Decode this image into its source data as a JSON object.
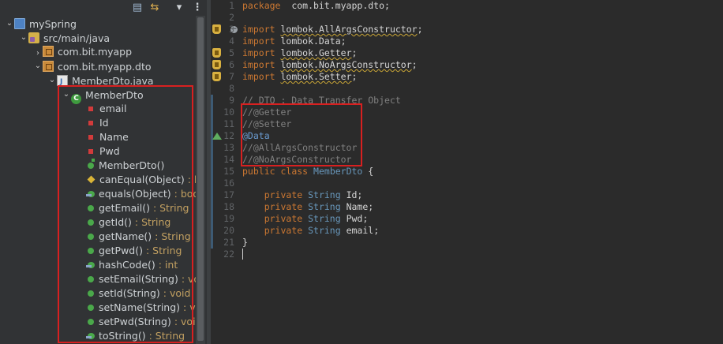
{
  "colors": {
    "highlight": "#d82020",
    "keyword": "#cc7832",
    "type": "#6897bb",
    "comment": "#808080",
    "annotation": "#6a9bd0",
    "return_type": "#c2a061"
  },
  "toolbar": {
    "icons": [
      "collapse-all-icon",
      "link-with-editor-icon",
      "filter-icon",
      "view-menu-icon"
    ],
    "menu_glyph": "⋮"
  },
  "tree": [
    {
      "label": "mySpring",
      "return": "",
      "icon": "project-icon",
      "expanded": true
    },
    {
      "label": "src/main/java",
      "return": "",
      "icon": "source-folder-icon",
      "expanded": true
    },
    {
      "label": "com.bit.myapp",
      "return": "",
      "icon": "package-icon",
      "expanded": false
    },
    {
      "label": "com.bit.myapp.dto",
      "return": "",
      "icon": "package-icon",
      "expanded": true
    },
    {
      "label": "MemberDto.java",
      "return": "",
      "icon": "java-file-icon",
      "expanded": true
    },
    {
      "label": "MemberDto",
      "return": "",
      "icon": "class-icon",
      "expanded": true
    },
    {
      "label": "email",
      "return": "",
      "icon": "private-field-icon"
    },
    {
      "label": "Id",
      "return": "",
      "icon": "private-field-icon"
    },
    {
      "label": "Name",
      "return": "",
      "icon": "private-field-icon"
    },
    {
      "label": "Pwd",
      "return": "",
      "icon": "private-field-icon"
    },
    {
      "label": "MemberDto()",
      "return": "",
      "icon": "constructor-icon"
    },
    {
      "label": "canEqual(Object)",
      "return": " : boo",
      "icon": "protected-method-icon"
    },
    {
      "label": "equals(Object)",
      "return": " : boolea",
      "icon": "override-method-icon"
    },
    {
      "label": "getEmail()",
      "return": " : String",
      "icon": "public-method-icon"
    },
    {
      "label": "getId()",
      "return": " : String",
      "icon": "public-method-icon"
    },
    {
      "label": "getName()",
      "return": " : String",
      "icon": "public-method-icon"
    },
    {
      "label": "getPwd()",
      "return": " : String",
      "icon": "public-method-icon"
    },
    {
      "label": "hashCode()",
      "return": " : int",
      "icon": "override-method-icon"
    },
    {
      "label": "setEmail(String)",
      "return": " : void",
      "icon": "public-method-icon"
    },
    {
      "label": "setId(String)",
      "return": " : void",
      "icon": "public-method-icon"
    },
    {
      "label": "setName(String)",
      "return": " : void",
      "icon": "public-method-icon"
    },
    {
      "label": "setPwd(String)",
      "return": " : void",
      "icon": "public-method-icon"
    },
    {
      "label": "toString()",
      "return": " : String",
      "icon": "override-method-icon"
    }
  ],
  "editor": {
    "line_numbers": [
      "1",
      "2",
      "3",
      "4",
      "5",
      "6",
      "7",
      "8",
      "9",
      "10",
      "11",
      "12",
      "13",
      "14",
      "15",
      "16",
      "17",
      "18",
      "19",
      "20",
      "21",
      "22"
    ],
    "lines": [
      [
        [
          "kw",
          "package"
        ],
        [
          "",
          "  com.bit.myapp.dto;"
        ]
      ],
      [],
      [
        [
          "kw",
          "import"
        ],
        [
          "",
          " "
        ],
        [
          "sq",
          "lombok.AllArgsConstructor"
        ],
        [
          "",
          ";"
        ]
      ],
      [
        [
          "kw",
          "import"
        ],
        [
          "",
          " lombok.Data;"
        ]
      ],
      [
        [
          "kw",
          "import"
        ],
        [
          "",
          " "
        ],
        [
          "sq",
          "lombok.Getter"
        ],
        [
          "",
          ";"
        ]
      ],
      [
        [
          "kw",
          "import"
        ],
        [
          "",
          " "
        ],
        [
          "sq",
          "lombok.NoArgsConstructor"
        ],
        [
          "",
          ";"
        ]
      ],
      [
        [
          "kw",
          "import"
        ],
        [
          "",
          " "
        ],
        [
          "sq",
          "lombok.Setter"
        ],
        [
          "",
          ";"
        ]
      ],
      [],
      [
        [
          "cm",
          "// DTO : Data Transfer Object"
        ]
      ],
      [
        [
          "cm",
          "//@Getter"
        ]
      ],
      [
        [
          "cm",
          "//@Setter"
        ]
      ],
      [
        [
          "an",
          "@Data"
        ]
      ],
      [
        [
          "cm",
          "//@AllArgsConstructor"
        ]
      ],
      [
        [
          "cm",
          "//@NoArgsConstructor"
        ]
      ],
      [
        [
          "kw",
          "public"
        ],
        [
          "",
          " "
        ],
        [
          "kw",
          "class"
        ],
        [
          "",
          " "
        ],
        [
          "typ",
          "MemberDto"
        ],
        [
          "",
          " {"
        ]
      ],
      [],
      [
        [
          "",
          "    "
        ],
        [
          "kw",
          "private"
        ],
        [
          "",
          " "
        ],
        [
          "typ",
          "String"
        ],
        [
          "",
          " Id;"
        ]
      ],
      [
        [
          "",
          "    "
        ],
        [
          "kw",
          "private"
        ],
        [
          "",
          " "
        ],
        [
          "typ",
          "String"
        ],
        [
          "",
          " Name;"
        ]
      ],
      [
        [
          "",
          "    "
        ],
        [
          "kw",
          "private"
        ],
        [
          "",
          " "
        ],
        [
          "typ",
          "String"
        ],
        [
          "",
          " Pwd;"
        ]
      ],
      [
        [
          "",
          "    "
        ],
        [
          "kw",
          "private"
        ],
        [
          "",
          " "
        ],
        [
          "typ",
          "String"
        ],
        [
          "",
          " email;"
        ]
      ],
      [
        [
          "",
          "}"
        ]
      ],
      [
        [
          "caret",
          ""
        ]
      ]
    ]
  }
}
